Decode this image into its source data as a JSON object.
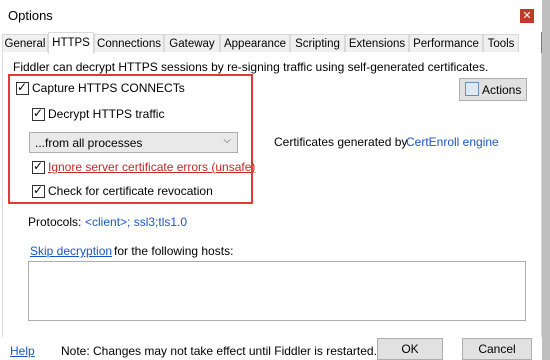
{
  "window": {
    "title": "Options"
  },
  "tabs": [
    "General",
    "HTTPS",
    "Connections",
    "Gateway",
    "Appearance",
    "Scripting",
    "Extensions",
    "Performance",
    "Tools"
  ],
  "panel": {
    "intro": "Fiddler can decrypt HTTPS sessions by re-signing traffic using self-generated certificates.",
    "capture_label": "Capture HTTPS CONNECTs",
    "decrypt_label": "Decrypt HTTPS traffic",
    "process_select": "...from all processes",
    "ignore_label": "Ignore server certificate errors (unsafe)",
    "revocation_label": "Check for certificate revocation",
    "actions_label": "Actions",
    "cert_text": "Certificates generated by",
    "cert_link": "CertEnroll engine",
    "protocols_label": "Protocols:",
    "protocols_value": "<client>; ssl3;tls1.0",
    "skip_link": "Skip decryption",
    "skip_text": "for the following hosts:"
  },
  "footer": {
    "help": "Help",
    "note": "Note: Changes may not take effect until Fiddler is restarted.",
    "ok": "OK",
    "cancel": "Cancel"
  },
  "colors": {
    "highlight_border": "#e53935",
    "link": "#1a55c8",
    "warning_text": "#c62828"
  }
}
